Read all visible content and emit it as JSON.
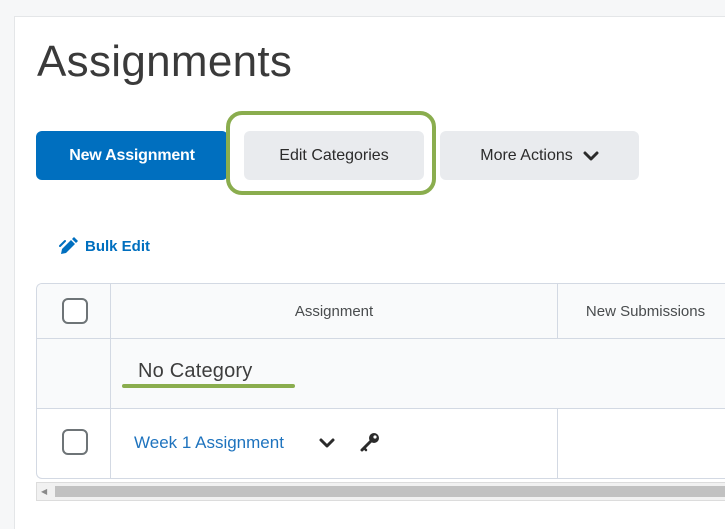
{
  "page": {
    "title": "Assignments"
  },
  "toolbar": {
    "new_assignment_label": "New Assignment",
    "edit_categories_label": "Edit Categories",
    "more_actions_label": "More Actions"
  },
  "bulk_edit": {
    "label": "Bulk Edit"
  },
  "table": {
    "columns": [
      "",
      "Assignment",
      "New Submissions"
    ],
    "category_row": {
      "label": "No Category"
    },
    "rows": [
      {
        "name": "Week 1 Assignment",
        "new_submissions": ""
      }
    ]
  },
  "colors": {
    "primary": "#006fbf",
    "highlight": "#8aad4e",
    "link": "#1e73be"
  },
  "icons": {
    "more_actions": "chevron-down-icon",
    "bulk_edit": "pencil-icon",
    "row_menu": "chevron-down-icon",
    "row_key": "key-icon"
  }
}
